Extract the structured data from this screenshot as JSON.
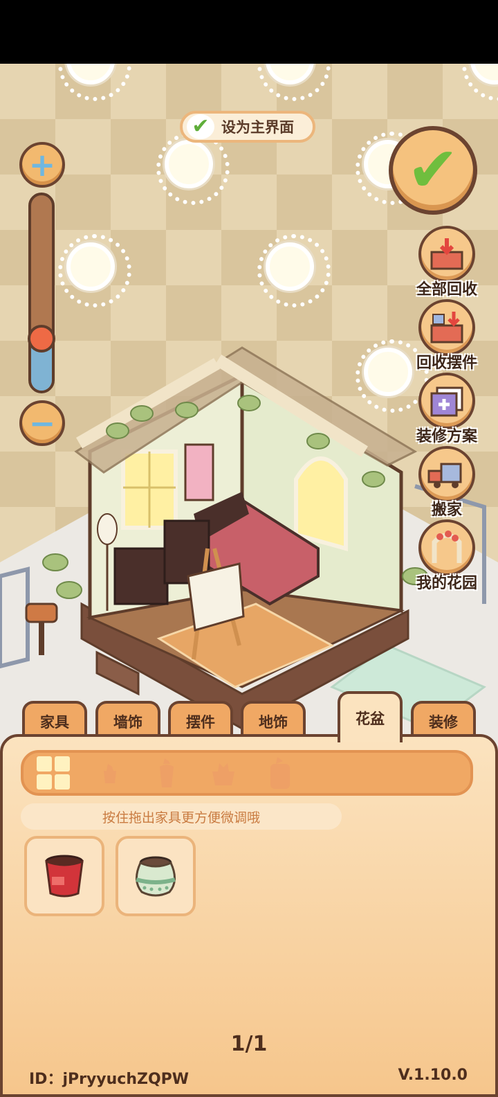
{
  "set_home_label": "设为主界面",
  "side_buttons": [
    {
      "label": "全部回收",
      "icon": "box-recycle-all-icon"
    },
    {
      "label": "回收摆件",
      "icon": "box-recycle-item-icon"
    },
    {
      "label": "装修方案",
      "icon": "decoration-plan-icon"
    },
    {
      "label": "搬家",
      "icon": "moving-truck-icon"
    },
    {
      "label": "我的花园",
      "icon": "garden-arch-icon"
    }
  ],
  "zoom_level": 0.28,
  "tabs": [
    {
      "label": "家具",
      "active": false
    },
    {
      "label": "墙饰",
      "active": false
    },
    {
      "label": "摆件",
      "active": false
    },
    {
      "label": "地饰",
      "active": false
    },
    {
      "label": "花盆",
      "active": true
    },
    {
      "label": "装修",
      "active": false
    }
  ],
  "filter_icons": [
    "all-grid-icon",
    "small-pot-icon",
    "tall-pot-icon",
    "planter-icon",
    "vase-pot-icon"
  ],
  "hint": "按住拖出家具更方便微调哦",
  "items": [
    {
      "name": "red-bucket-pot"
    },
    {
      "name": "green-jar-pot"
    }
  ],
  "page_indicator": "1/1",
  "user_id": "ID：jPryyuchZQPW",
  "version": "V.1.10.0",
  "colors": {
    "accent": "#f0a864",
    "border": "#6b4330",
    "check": "#6fbe3e"
  }
}
